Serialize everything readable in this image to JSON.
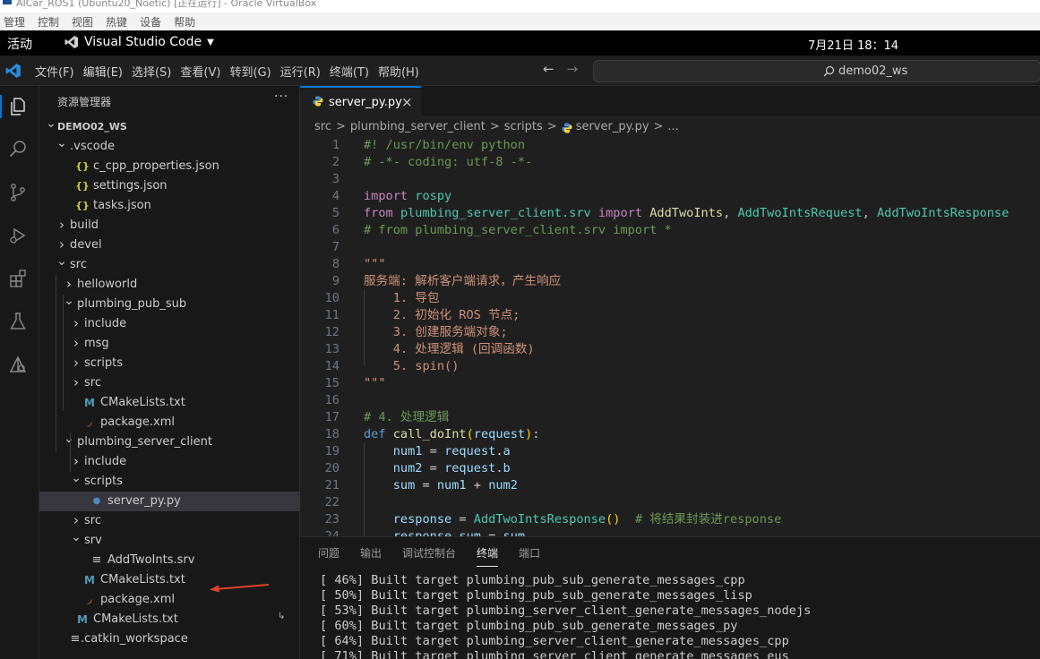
{
  "vbox": {
    "title": "AICar_ROS1 (Ubuntu20_Noetic) [正在运行] - Oracle VirtualBox",
    "menu": [
      "管理",
      "控制",
      "视图",
      "热键",
      "设备",
      "帮助"
    ]
  },
  "gnome": {
    "activities": "活动",
    "app_name": "Visual Studio Code",
    "clock": "7月21日  18：14"
  },
  "vscode": {
    "menus": [
      "文件(F)",
      "编辑(E)",
      "选择(S)",
      "查看(V)",
      "转到(G)",
      "运行(R)",
      "终端(T)",
      "帮助(H)"
    ],
    "search_text": "demo02_ws",
    "nav_back": "←",
    "nav_forward": "→"
  },
  "sidebar": {
    "title": "资源管理器",
    "more": "···",
    "rows": [
      {
        "label": "DEMO02_WS",
        "depth": 0,
        "chev": "v",
        "icon": ""
      },
      {
        "label": ".vscode",
        "depth": 1,
        "chev": "v",
        "icon": ""
      },
      {
        "label": "c_cpp_properties.json",
        "depth": 2,
        "chev": "",
        "icon": "{}"
      },
      {
        "label": "settings.json",
        "depth": 2,
        "chev": "",
        "icon": "{}"
      },
      {
        "label": "tasks.json",
        "depth": 2,
        "chev": "",
        "icon": "{}"
      },
      {
        "label": "build",
        "depth": 1,
        "chev": ">",
        "icon": ""
      },
      {
        "label": "devel",
        "depth": 1,
        "chev": ">",
        "icon": ""
      },
      {
        "label": "src",
        "depth": 1,
        "chev": "v",
        "icon": ""
      },
      {
        "label": "helloworld",
        "depth": 2,
        "chev": ">",
        "icon": ""
      },
      {
        "label": "plumbing_pub_sub",
        "depth": 2,
        "chev": "v",
        "icon": ""
      },
      {
        "label": "include",
        "depth": 3,
        "chev": ">",
        "icon": ""
      },
      {
        "label": "msg",
        "depth": 3,
        "chev": ">",
        "icon": ""
      },
      {
        "label": "scripts",
        "depth": 3,
        "chev": ">",
        "icon": ""
      },
      {
        "label": "src",
        "depth": 3,
        "chev": ">",
        "icon": ""
      },
      {
        "label": "CMakeLists.txt",
        "depth": 3,
        "chev": "",
        "icon": "M"
      },
      {
        "label": "package.xml",
        "depth": 3,
        "chev": "",
        "icon": "rss"
      },
      {
        "label": "plumbing_server_client",
        "depth": 2,
        "chev": "v",
        "icon": ""
      },
      {
        "label": "include",
        "depth": 3,
        "chev": ">",
        "icon": ""
      },
      {
        "label": "scripts",
        "depth": 3,
        "chev": "v",
        "icon": ""
      },
      {
        "label": "server_py.py",
        "depth": 4,
        "chev": "",
        "icon": "py"
      },
      {
        "label": "src",
        "depth": 3,
        "chev": ">",
        "icon": ""
      },
      {
        "label": "srv",
        "depth": 3,
        "chev": "v",
        "icon": ""
      },
      {
        "label": "AddTwoInts.srv",
        "depth": 4,
        "chev": "",
        "icon": "≡"
      },
      {
        "label": "CMakeLists.txt",
        "depth": 3,
        "chev": "",
        "icon": "M"
      },
      {
        "label": "package.xml",
        "depth": 3,
        "chev": "",
        "icon": "rss"
      },
      {
        "label": "CMakeLists.txt",
        "depth": 2,
        "chev": "",
        "icon": "M"
      },
      {
        "label": ".catkin_workspace",
        "depth": 1,
        "chev": "",
        "icon": "≡"
      }
    ]
  },
  "editor": {
    "tab_name": "server_py.py",
    "tab_close": "×",
    "breadcrumb": [
      "src",
      ">",
      "plumbing_server_client",
      ">",
      "scripts",
      ">",
      "server_py.py",
      ">",
      "..."
    ],
    "lines": [
      {
        "n": "1",
        "t": [
          [
            "c-com",
            "#! /usr/bin/env python"
          ]
        ]
      },
      {
        "n": "2",
        "t": [
          [
            "c-com",
            "# -*- coding: utf-8 -*-"
          ]
        ]
      },
      {
        "n": "3",
        "t": []
      },
      {
        "n": "4",
        "t": [
          [
            "c-ctl",
            "import"
          ],
          [
            "c-plain",
            " "
          ],
          [
            "c-mod",
            "rospy"
          ]
        ]
      },
      {
        "n": "5",
        "t": [
          [
            "c-ctl",
            "from"
          ],
          [
            "c-plain",
            " "
          ],
          [
            "c-mod",
            "plumbing_server_client.srv"
          ],
          [
            "c-plain",
            " "
          ],
          [
            "c-ctl",
            "import"
          ],
          [
            "c-plain",
            " "
          ],
          [
            "c-fn",
            "AddTwoInts"
          ],
          [
            "c-plain",
            ", "
          ],
          [
            "c-cls",
            "AddTwoIntsRequest"
          ],
          [
            "c-plain",
            ", "
          ],
          [
            "c-cls",
            "AddTwoIntsResponse"
          ]
        ]
      },
      {
        "n": "6",
        "t": [
          [
            "c-com",
            "# from plumbing_server_client.srv import *"
          ]
        ]
      },
      {
        "n": "7",
        "t": []
      },
      {
        "n": "8",
        "t": [
          [
            "c-str",
            "\"\"\""
          ]
        ]
      },
      {
        "n": "9",
        "t": [
          [
            "c-str",
            "服务端: 解析客户端请求，产生响应"
          ]
        ]
      },
      {
        "n": "10",
        "t": [
          [
            "c-str",
            "    1. 导包"
          ]
        ]
      },
      {
        "n": "11",
        "t": [
          [
            "c-str",
            "    2. 初始化 ROS 节点;"
          ]
        ]
      },
      {
        "n": "12",
        "t": [
          [
            "c-str",
            "    3. 创建服务端对象;"
          ]
        ]
      },
      {
        "n": "13",
        "t": [
          [
            "c-str",
            "    4. 处理逻辑 (回调函数)"
          ]
        ]
      },
      {
        "n": "14",
        "t": [
          [
            "c-str",
            "    5. spin()"
          ]
        ]
      },
      {
        "n": "15",
        "t": [
          [
            "c-str",
            "\"\"\""
          ]
        ]
      },
      {
        "n": "16",
        "t": []
      },
      {
        "n": "17",
        "t": [
          [
            "c-com",
            "# 4. 处理逻辑"
          ]
        ]
      },
      {
        "n": "18",
        "t": [
          [
            "c-kw",
            "def"
          ],
          [
            "c-plain",
            " "
          ],
          [
            "c-fn",
            "call_doInt"
          ],
          [
            "c-br",
            "("
          ],
          [
            "c-var",
            "request"
          ],
          [
            "c-br",
            ")"
          ],
          [
            "c-plain",
            ":"
          ]
        ]
      },
      {
        "n": "19",
        "t": [
          [
            "c-plain",
            "    "
          ],
          [
            "c-var",
            "num1"
          ],
          [
            "c-plain",
            " = "
          ],
          [
            "c-var",
            "request"
          ],
          [
            "c-plain",
            "."
          ],
          [
            "c-var",
            "a"
          ]
        ]
      },
      {
        "n": "20",
        "t": [
          [
            "c-plain",
            "    "
          ],
          [
            "c-var",
            "num2"
          ],
          [
            "c-plain",
            " = "
          ],
          [
            "c-var",
            "request"
          ],
          [
            "c-plain",
            "."
          ],
          [
            "c-var",
            "b"
          ]
        ]
      },
      {
        "n": "21",
        "t": [
          [
            "c-plain",
            "    "
          ],
          [
            "c-var",
            "sum"
          ],
          [
            "c-plain",
            " = "
          ],
          [
            "c-var",
            "num1"
          ],
          [
            "c-plain",
            " + "
          ],
          [
            "c-var",
            "num2"
          ]
        ]
      },
      {
        "n": "22",
        "t": []
      },
      {
        "n": "23",
        "t": [
          [
            "c-plain",
            "    "
          ],
          [
            "c-var",
            "response"
          ],
          [
            "c-plain",
            " = "
          ],
          [
            "c-cls",
            "AddTwoIntsResponse"
          ],
          [
            "c-br",
            "()"
          ],
          [
            "c-plain",
            "  "
          ],
          [
            "c-com",
            "# 将结果封装进response"
          ]
        ]
      },
      {
        "n": "24",
        "t": [
          [
            "c-plain",
            "    "
          ],
          [
            "c-var",
            "response"
          ],
          [
            "c-plain",
            "."
          ],
          [
            "c-var",
            "sum"
          ],
          [
            "c-plain",
            " = "
          ],
          [
            "c-var",
            "sum"
          ]
        ]
      }
    ]
  },
  "panel": {
    "tabs": [
      "问题",
      "输出",
      "调试控制台",
      "终端",
      "端口"
    ],
    "active_tab": "终端",
    "terminal_lines": [
      "[ 46%] Built target plumbing_pub_sub_generate_messages_cpp",
      "[ 50%] Built target plumbing_pub_sub_generate_messages_lisp",
      "[ 53%] Built target plumbing_server_client_generate_messages_nodejs",
      "[ 60%] Built target plumbing_pub_sub_generate_messages_py",
      "[ 64%] Built target plumbing_server_client_generate_messages_cpp",
      "[ 71%] Built target plumbing_server_client_generate_messages_eus"
    ]
  },
  "colors": {
    "accent": "#0078d4",
    "annotation_arrow": "#e0412b"
  }
}
